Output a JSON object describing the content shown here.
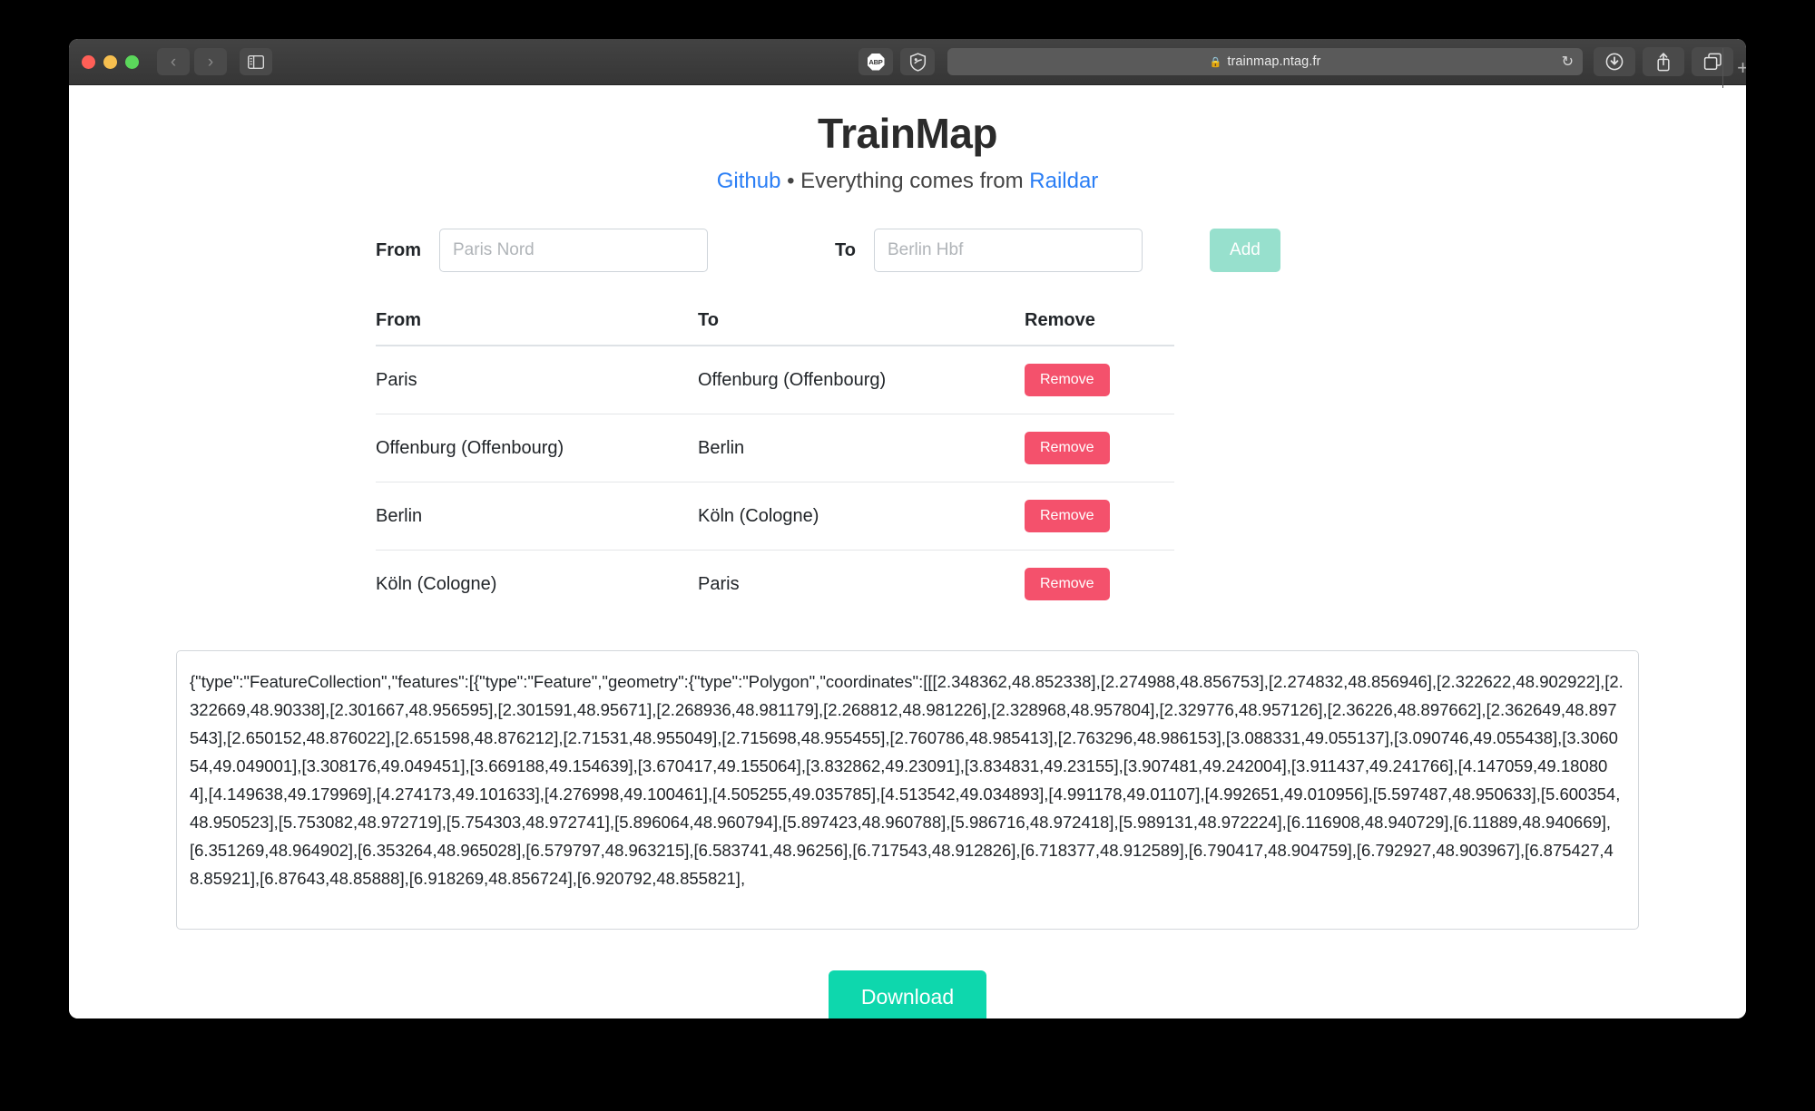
{
  "browser": {
    "url": "trainmap.ntag.fr",
    "lock_icon": "lock-icon",
    "back_icon": "chevron-left-icon",
    "forward_icon": "chevron-right-icon",
    "sidebar_icon": "sidebar-toggle-icon",
    "adblock_label": "ABP",
    "shield_icon": "shield-icon",
    "reload_icon": "reload-icon",
    "downloads_icon": "downloads-icon",
    "share_icon": "share-icon",
    "tabs_icon": "tab-overview-icon",
    "newtab_label": "+"
  },
  "header": {
    "title": "TrainMap",
    "subtitle_link1": "Github",
    "subtitle_bullet": "•",
    "subtitle_middle": "Everything comes from",
    "subtitle_link2": "Raildar"
  },
  "form": {
    "from_label": "From",
    "from_placeholder": "Paris Nord",
    "from_value": "",
    "to_label": "To",
    "to_placeholder": "Berlin Hbf",
    "to_value": "",
    "add_label": "Add",
    "add_color": "#97e0cd"
  },
  "table": {
    "headers": [
      "From",
      "To",
      "Remove"
    ],
    "remove_label": "Remove",
    "remove_color": "#f4516c",
    "rows": [
      {
        "from": "Paris",
        "to": "Offenburg (Offenbourg)"
      },
      {
        "from": "Offenburg (Offenbourg)",
        "to": "Berlin"
      },
      {
        "from": "Berlin",
        "to": "Köln (Cologne)"
      },
      {
        "from": "Köln (Cologne)",
        "to": "Paris"
      }
    ]
  },
  "geojson": {
    "value": "{\"type\":\"FeatureCollection\",\"features\":[{\"type\":\"Feature\",\"geometry\":{\"type\":\"Polygon\",\"coordinates\":[[[2.348362,48.852338],[2.274988,48.856753],[2.274832,48.856946],[2.322622,48.902922],[2.322669,48.90338],[2.301667,48.956595],[2.301591,48.95671],[2.268936,48.981179],[2.268812,48.981226],[2.328968,48.957804],[2.329776,48.957126],[2.36226,48.897662],[2.362649,48.897543],[2.650152,48.876022],[2.651598,48.876212],[2.71531,48.955049],[2.715698,48.955455],[2.760786,48.985413],[2.763296,48.986153],[3.088331,49.055137],[3.090746,49.055438],[3.306054,49.049001],[3.308176,49.049451],[3.669188,49.154639],[3.670417,49.155064],[3.832862,49.23091],[3.834831,49.23155],[3.907481,49.242004],[3.911437,49.241766],[4.147059,49.180804],[4.149638,49.179969],[4.274173,49.101633],[4.276998,49.100461],[4.505255,49.035785],[4.513542,49.034893],[4.991178,49.01107],[4.992651,49.010956],[5.597487,48.950633],[5.600354,48.950523],[5.753082,48.972719],[5.754303,48.972741],[5.896064,48.960794],[5.897423,48.960788],[5.986716,48.972418],[5.989131,48.972224],[6.116908,48.940729],[6.11889,48.940669],[6.351269,48.964902],[6.353264,48.965028],[6.579797,48.963215],[6.583741,48.96256],[6.717543,48.912826],[6.718377,48.912589],[6.790417,48.904759],[6.792927,48.903967],[6.875427,48.85921],[6.87643,48.85888],[6.918269,48.856724],[6.920792,48.855821],"
  },
  "download": {
    "label": "Download",
    "color": "#0ed7ad"
  }
}
